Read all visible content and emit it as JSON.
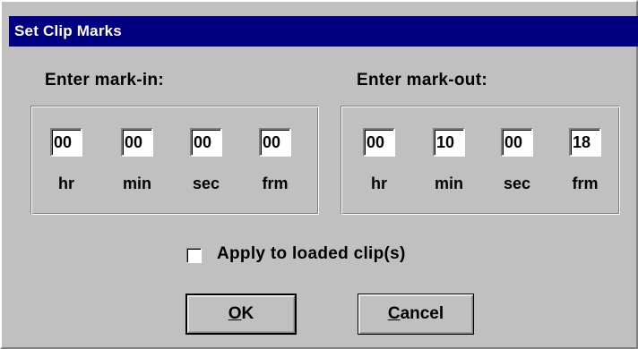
{
  "window": {
    "title": "Set Clip Marks"
  },
  "mark_in": {
    "label": "Enter mark-in:",
    "fields": [
      {
        "value": "00",
        "unit": "hr"
      },
      {
        "value": "00",
        "unit": "min"
      },
      {
        "value": "00",
        "unit": "sec"
      },
      {
        "value": "00",
        "unit": "frm"
      }
    ]
  },
  "mark_out": {
    "label": "Enter mark-out:",
    "fields": [
      {
        "value": "00",
        "unit": "hr"
      },
      {
        "value": "10",
        "unit": "min"
      },
      {
        "value": "00",
        "unit": "sec"
      },
      {
        "value": "18",
        "unit": "frm"
      }
    ]
  },
  "apply": {
    "label": "Apply to loaded clip(s)",
    "checked": false
  },
  "buttons": {
    "ok": {
      "mnemonic": "O",
      "rest": "K"
    },
    "cancel": {
      "mnemonic": "C",
      "rest": "ancel"
    }
  },
  "colors": {
    "face": "#c0c0c0",
    "title_bar": "#000080",
    "title_text": "#ffffff"
  }
}
